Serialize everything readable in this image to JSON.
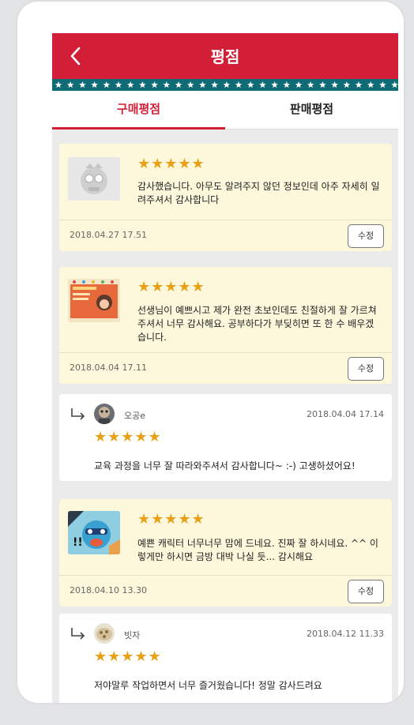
{
  "header": {
    "title": "평점",
    "back_icon": "chevron-left-icon"
  },
  "tabs": [
    {
      "label": "구매평점",
      "active": true
    },
    {
      "label": "판매평점",
      "active": false
    }
  ],
  "colors": {
    "brand_red": "#d21f37",
    "strip_teal": "#0f6c74",
    "star_gold": "#e8a116",
    "card_cream": "#fdf8dc"
  },
  "reviews": [
    {
      "stars": "★★★★★",
      "rating": 5,
      "text": "감사했습니다. 아무도 알려주지 않던 정보인데 아주 자세히 일려주셔서 감사합니다",
      "date": "2018.04.27 17.51",
      "edit_label": "수정"
    },
    {
      "stars": "★★★★★",
      "rating": 5,
      "text": "선생님이 예쁘시고 제가 완전 초보인데도 친절하게 잘 가르쳐주셔서 너무 감사해요. 공부하다가 부딪히면 또 한 수 배우겠습니다.",
      "date": "2018.04.04 17.11",
      "edit_label": "수정",
      "reply": {
        "name": "오공e",
        "date": "2018.04.04 17.14",
        "stars": "★★★★★",
        "rating": 5,
        "text": "교육 과정을 너무 잘 따라와주셔서 감사합니다~ :-) 고생하셨어요!"
      }
    },
    {
      "stars": "★★★★★",
      "rating": 5,
      "text": "예쁜 캐릭터 너무너무 맘에 드네요. 진짜 잘 하시네요. ^^ 이렇게만 하시면 금방 대박 나실 듯... 감시해요",
      "date": "2018.04.10 13.30",
      "edit_label": "수정",
      "reply": {
        "name": "빗자",
        "date": "2018.04.12 11.33",
        "stars": "★★★★★",
        "rating": 5,
        "text": "저야말루 작업하면서 너무 즐거웠습니다! 정말 감사드려요"
      }
    }
  ]
}
